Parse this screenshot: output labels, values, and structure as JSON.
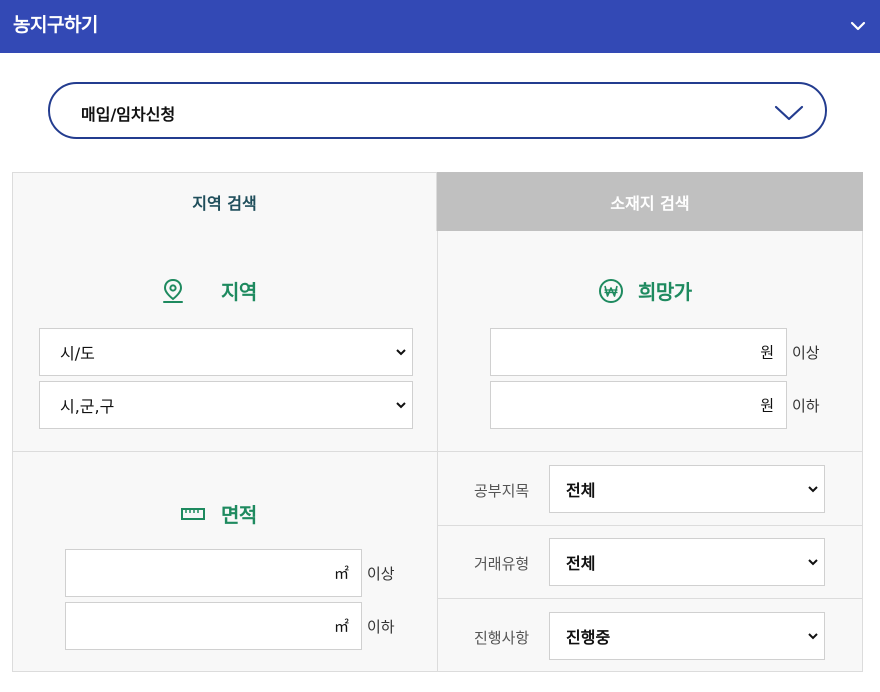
{
  "header": {
    "title": "농지구하기",
    "toggle_icon": "chevron-down-icon"
  },
  "type_select": {
    "value": "매입/임차신청",
    "icon": "chevron-down-icon"
  },
  "tabs": [
    {
      "label": "지역 검색",
      "active": true
    },
    {
      "label": "소재지 검색",
      "active": false
    }
  ],
  "region": {
    "title": "지역",
    "icon": "map-pin-icon",
    "province_select": "시/도",
    "district_select": "시,군,구"
  },
  "price": {
    "title": "희망가",
    "icon": "won-icon",
    "unit": "원",
    "min_suffix": "이상",
    "max_suffix": "이하"
  },
  "area": {
    "title": "면적",
    "icon": "ruler-icon",
    "unit": "㎡",
    "min_suffix": "이상",
    "max_suffix": "이하"
  },
  "land_category": {
    "label": "공부지목",
    "value": "전체"
  },
  "deal_type": {
    "label": "거래유형",
    "value": "전체"
  },
  "status": {
    "label": "진행사항",
    "value": "진행중"
  },
  "colors": {
    "header": "#3349b5",
    "accent_green": "#1e8a5f",
    "select_border": "#233c8f",
    "inactive_tab": "#c0c0c0"
  }
}
